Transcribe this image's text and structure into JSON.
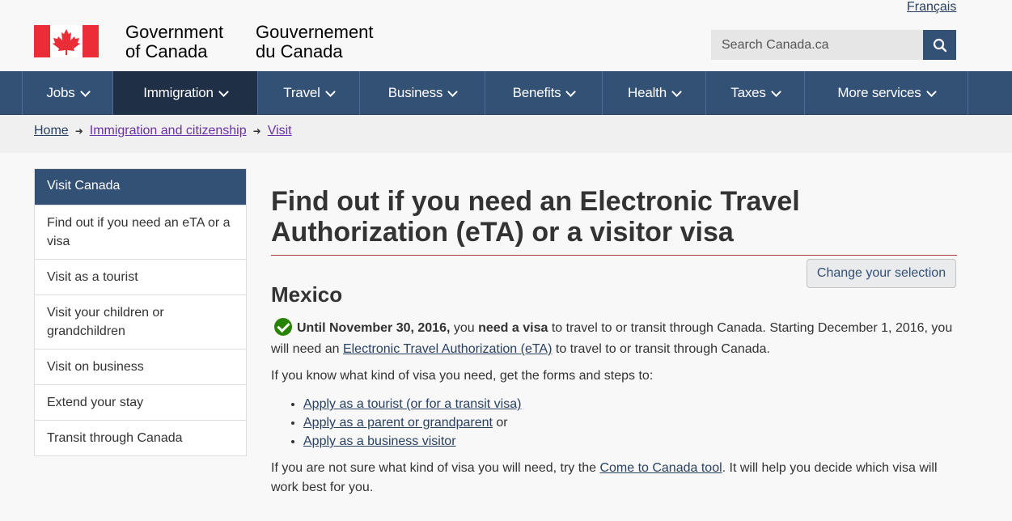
{
  "header": {
    "language_link": "Français",
    "gov_en_line1": "Government",
    "gov_en_line2": "of Canada",
    "gov_fr_line1": "Gouvernement",
    "gov_fr_line2": "du Canada",
    "search_placeholder": "Search Canada.ca",
    "search_icon": "search-icon"
  },
  "nav": {
    "items": [
      {
        "label": "Jobs"
      },
      {
        "label": "Immigration"
      },
      {
        "label": "Travel"
      },
      {
        "label": "Business"
      },
      {
        "label": "Benefits"
      },
      {
        "label": "Health"
      },
      {
        "label": "Taxes"
      },
      {
        "label": "More services"
      }
    ]
  },
  "breadcrumb": {
    "items": [
      "Home",
      "Immigration and citizenship",
      "Visit"
    ]
  },
  "sidebar": {
    "title": "Visit Canada",
    "items": [
      "Find out if you need an eTA or a visa",
      "Visit as a tourist",
      "Visit your children or grandchildren",
      "Visit on business",
      "Extend your stay",
      "Transit through Canada"
    ]
  },
  "main": {
    "title": "Find out if you need an Electronic Travel Authorization (eTA) or a visitor visa",
    "change_button": "Change your selection",
    "country": "Mexico",
    "p1_bold1": "Until November 30, 2016,",
    "p1_text1": " you ",
    "p1_bold2": "need a visa",
    "p1_text2": " to travel to or transit through Canada. Starting December 1, 2016, you will need an ",
    "p1_link": "Electronic Travel Authorization (eTA)",
    "p1_text3": " to travel to or transit through Canada.",
    "p2": "If you know what kind of visa you need, get the forms and steps to:",
    "list": [
      {
        "link": "Apply as a tourist (or for a transit visa)",
        "suffix": ""
      },
      {
        "link": "Apply as a parent or grandparent",
        "suffix": " or"
      },
      {
        "link": "Apply as a business visitor",
        "suffix": ""
      }
    ],
    "p3_text1": "If you are not sure what kind of visa you will need, try the ",
    "p3_link": "Come to Canada tool",
    "p3_text2": ". It will help you decide which visa will work best for you."
  },
  "colors": {
    "nav_bg": "#335075",
    "nav_active": "#1f2f45",
    "flag_red": "#eb2d37",
    "title_rule": "#af3c43",
    "check_green": "#278400"
  }
}
